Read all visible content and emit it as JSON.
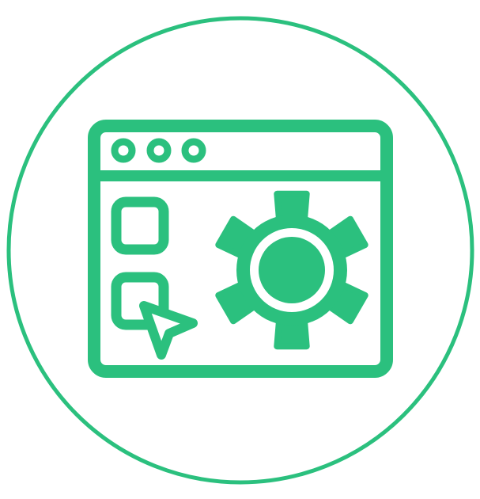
{
  "icon": {
    "name": "browser-settings-icon",
    "accent": "#2BC07E",
    "background": "#ffffff"
  }
}
